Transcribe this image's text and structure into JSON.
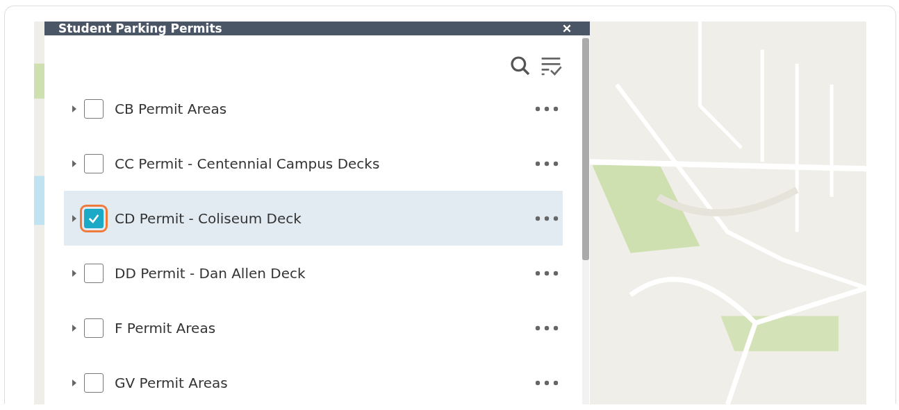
{
  "panel": {
    "title": "Student Parking Permits",
    "layers": [
      {
        "label": "CB Permit Areas",
        "checked": false,
        "selected": false,
        "highlighted": false
      },
      {
        "label": "CC Permit - Centennial Campus Decks",
        "checked": false,
        "selected": false,
        "highlighted": false
      },
      {
        "label": "CD Permit - Coliseum Deck",
        "checked": true,
        "selected": true,
        "highlighted": true
      },
      {
        "label": "DD Permit - Dan Allen Deck",
        "checked": false,
        "selected": false,
        "highlighted": false
      },
      {
        "label": "F Permit Areas",
        "checked": false,
        "selected": false,
        "highlighted": false
      },
      {
        "label": "GV Permit Areas",
        "checked": false,
        "selected": false,
        "highlighted": false
      }
    ]
  }
}
